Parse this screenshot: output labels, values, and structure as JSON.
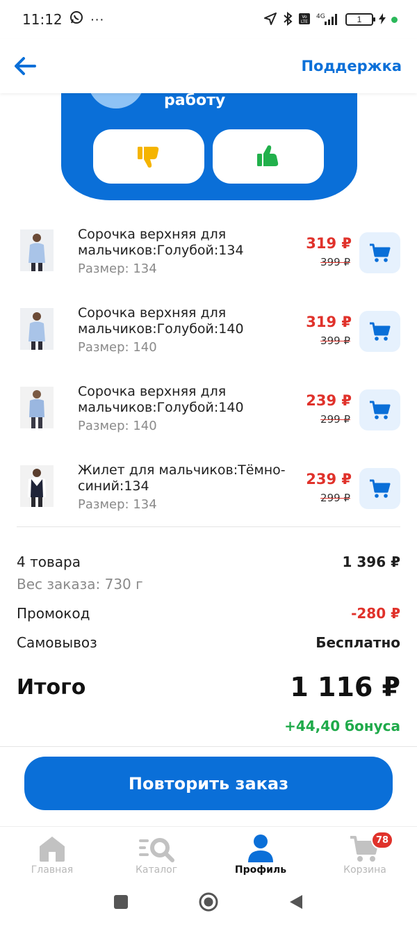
{
  "status_bar": {
    "time": "11:12",
    "dots": "···",
    "network": "4G",
    "battery": "1"
  },
  "header": {
    "support_label": "Поддержка"
  },
  "feedback": {
    "text": "работу"
  },
  "products": [
    {
      "name": "Сорочка верхняя для мальчиков:Голубой:134",
      "size": "Размер: 134",
      "price": "319 ₽",
      "old_price": "399 ₽"
    },
    {
      "name": "Сорочка верхняя для мальчиков:Голубой:140",
      "size": "Размер: 140",
      "price": "319 ₽",
      "old_price": "399 ₽"
    },
    {
      "name": "Сорочка верхняя для мальчиков:Голубой:140",
      "size": "Размер: 140",
      "price": "239 ₽",
      "old_price": "299 ₽"
    },
    {
      "name": "Жилет для мальчиков:Тёмно-синий:134",
      "size": "Размер: 134",
      "price": "239 ₽",
      "old_price": "299 ₽"
    }
  ],
  "summary": {
    "items_label": "4 товара",
    "items_value": "1 396 ₽",
    "weight": "Вес заказа: 730 г",
    "promo_label": "Промокод",
    "promo_value": "-280 ₽",
    "pickup_label": "Самовывоз",
    "pickup_value": "Бесплатно",
    "total_label": "Итого",
    "total_value": "1 116 ₽",
    "bonus": "+44,40 бонуса"
  },
  "repeat_button": "Повторить заказ",
  "bottom_nav": [
    {
      "label": "Главная",
      "icon": "home-icon"
    },
    {
      "label": "Каталог",
      "icon": "catalog-search-icon"
    },
    {
      "label": "Профиль",
      "icon": "profile-icon",
      "active": true
    },
    {
      "label": "Корзина",
      "icon": "cart-icon",
      "badge": "78"
    }
  ],
  "colors": {
    "brand_blue": "#0a6fd8",
    "price_red": "#e0322b",
    "bonus_green": "#1faa4a"
  }
}
